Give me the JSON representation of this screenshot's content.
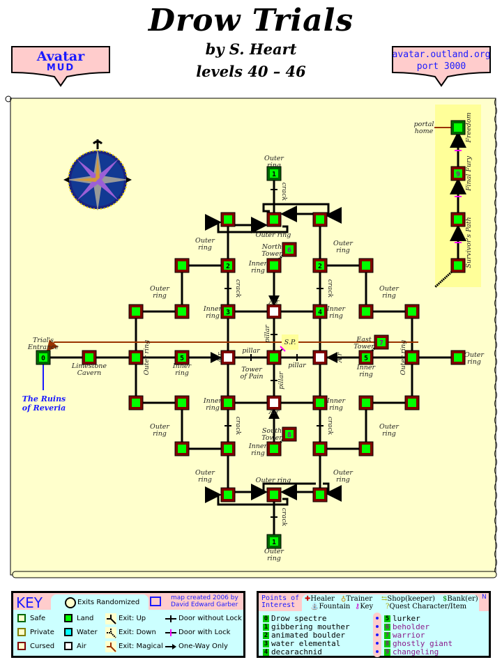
{
  "header": {
    "title": "Drow Trials",
    "author": "by S. Heart",
    "levels": "levels 40 – 46"
  },
  "left_shield": {
    "line1": "Avatar",
    "line2": "MUD"
  },
  "right_shield": {
    "line1": "avatar.outland.org",
    "line2": "port 3000"
  },
  "colors": {
    "parchment": "#ffffcc",
    "land": "#00ff00",
    "cursed_border": "#800000",
    "safe_border": "#006600",
    "air": "#ffffff",
    "magic_exit": "#993300",
    "locked_door": "#ff00ff",
    "link_blue": "#1a1aff",
    "key_bg": "#ccffff",
    "key_header_bg": "#ffcccc",
    "freedom_bg": "#ffff99"
  },
  "map": {
    "labels": {
      "outer_ring": "Outer ring",
      "outer": "Outer",
      "ring": "ring",
      "inner": "Inner",
      "crack": "crack",
      "pillar": "pillar",
      "air": "Air",
      "north": "North",
      "south": "South",
      "east": "East",
      "tower": "Tower",
      "tower_of": "Tower",
      "of_pain": "of Pain",
      "sp": "S.P.",
      "trials": "Trial's",
      "entrance": "Entrance",
      "limestone": "Limestone",
      "cavern": "Cavern",
      "ruins1": "The Ruins",
      "ruins2": "of Reveria",
      "portal1": "portal",
      "portal2": "home",
      "freedom": "Freedom",
      "final_fury": "Final Fury",
      "survivors_path": "Survivor's Path"
    },
    "node_numbers": {
      "entrance": "0",
      "top_mouther": "1",
      "bottom_mouther": "1",
      "boulder_left": "2",
      "boulder_right": "2",
      "water_elemental": "3",
      "decarachnid": "4",
      "lurker_left": "5",
      "lurker_right": "5",
      "beholder": "6",
      "warrior": "7",
      "ghostly_giant": "8",
      "changeling": "9"
    }
  },
  "key": {
    "title": "KEY",
    "exits_randomized": "Exits Randomized",
    "credit1": "map created 2006 by",
    "credit2": "David Edward Garber",
    "safe": "Safe",
    "private": "Private",
    "cursed": "Cursed",
    "land": "Land",
    "water": "Water",
    "air": "Air",
    "exit_up": "Exit: Up",
    "exit_down": "Exit: Down",
    "exit_magical": "Exit: Magical",
    "door_no_lock": "Door without Lock",
    "door_lock": "Door with Lock",
    "one_way": "One-Way Only"
  },
  "poi": {
    "title1": "Points of",
    "title2": "Interest",
    "healer": "Healer",
    "trainer": "Trainer",
    "shop": "Shop(keeper)",
    "bank": "Bank(er)",
    "fountain": "Fountain",
    "key": "Key",
    "quest": "Quest Character/Item",
    "compass": "N",
    "mobs": [
      {
        "num": "0",
        "name": "Drow spectre",
        "color": "#000000"
      },
      {
        "num": "1",
        "name": "gibbering mouther",
        "color": "#000000"
      },
      {
        "num": "2",
        "name": "animated boulder",
        "color": "#000000"
      },
      {
        "num": "3",
        "name": "water elemental",
        "color": "#000000"
      },
      {
        "num": "4",
        "name": "decarachnid",
        "color": "#000000"
      },
      {
        "num": "5",
        "name": "lurker",
        "color": "#000000"
      },
      {
        "num": "6",
        "name": "beholder",
        "color": "#8a1a8a"
      },
      {
        "num": "7",
        "name": "warrior",
        "color": "#8a1a8a"
      },
      {
        "num": "8",
        "name": "ghostly giant",
        "color": "#8a1a8a"
      },
      {
        "num": "9",
        "name": "changeling",
        "color": "#8a1a8a"
      }
    ]
  }
}
